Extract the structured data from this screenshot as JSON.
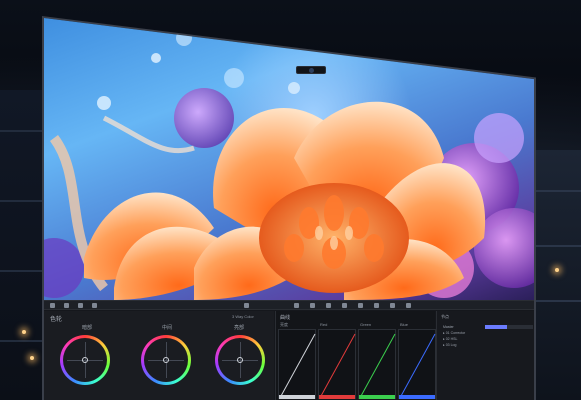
{
  "color_panel": {
    "title": "色轮",
    "mode": "3 Way Color",
    "wheels": [
      {
        "label": "暗部"
      },
      {
        "label": "中间"
      },
      {
        "label": "亮部"
      }
    ]
  },
  "curves_panel": {
    "title": "曲线",
    "columns": [
      "亮度",
      "Red",
      "Green",
      "Blue"
    ]
  },
  "nodes_panel": {
    "title": "节点",
    "items": [
      "Master",
      "▸ 01 Corrector",
      "▸ 02 HSL",
      "▸ 03 Log"
    ]
  },
  "colors": {
    "wheel_ring": "conic rainbow",
    "curve_red": "#e23b3b",
    "curve_green": "#3bcf4e",
    "curve_blue": "#3b6bff",
    "accent": "#6b7cff"
  }
}
